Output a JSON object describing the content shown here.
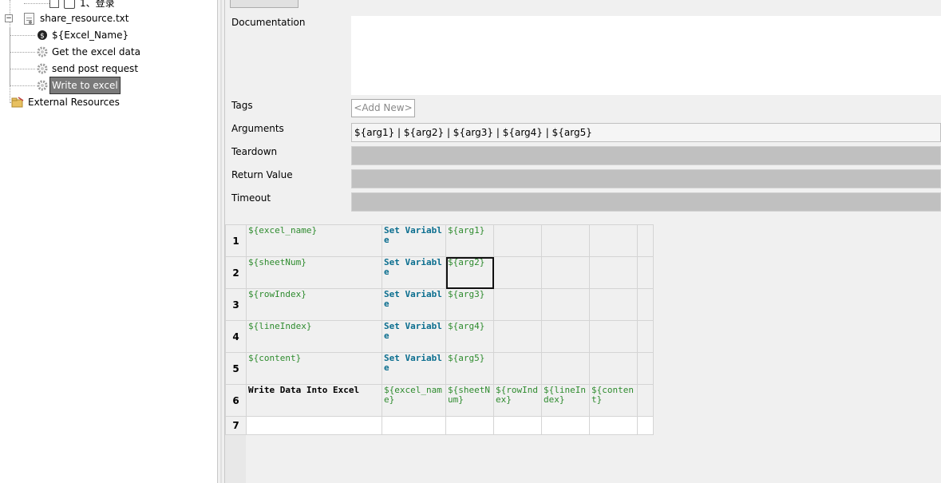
{
  "tree": {
    "top_item": "1、登录",
    "resource_file": "share_resource.txt",
    "children": [
      {
        "label": "${Excel_Name}",
        "icon": "variable-icon"
      },
      {
        "label": "Get the excel data",
        "icon": "gear-icon"
      },
      {
        "label": "send post request",
        "icon": "gear-icon"
      },
      {
        "label": "Write to excel",
        "icon": "gear-icon",
        "selected": true
      }
    ],
    "external": "External Resources"
  },
  "editor": {
    "fields": {
      "documentation": "Documentation",
      "tags": "Tags",
      "tags_add": "<Add New>",
      "arguments": "Arguments",
      "arguments_value": "${arg1} | ${arg2} | ${arg3} | ${arg4} | ${arg5}",
      "teardown": "Teardown",
      "return_value": "Return Value",
      "timeout": "Timeout"
    }
  },
  "grid": {
    "rows": [
      {
        "num": "1",
        "cells": [
          "${excel_name}",
          "Set Variable",
          "${arg1}",
          "",
          "",
          "",
          ""
        ]
      },
      {
        "num": "2",
        "cells": [
          "${sheetNum}",
          "Set Variable",
          "${arg2}",
          "",
          "",
          "",
          ""
        ]
      },
      {
        "num": "3",
        "cells": [
          "${rowIndex}",
          "Set Variable",
          "${arg3}",
          "",
          "",
          "",
          ""
        ]
      },
      {
        "num": "4",
        "cells": [
          "${lineIndex}",
          "Set Variable",
          "${arg4}",
          "",
          "",
          "",
          ""
        ]
      },
      {
        "num": "5",
        "cells": [
          "${content}",
          "Set Variable",
          "${arg5}",
          "",
          "",
          "",
          ""
        ]
      },
      {
        "num": "6",
        "cells": [
          "Write Data Into Excel",
          "${excel_name}",
          "${sheetNum}",
          "${rowIndex}",
          "${lineIndex}",
          "${content}",
          ""
        ]
      },
      {
        "num": "7",
        "cells": [
          "",
          "",
          "",
          "",
          "",
          "",
          ""
        ]
      }
    ],
    "selected_cell": "2-3"
  },
  "colors": {
    "variable": "#2e8b2e",
    "keyword": "#0b6e8f",
    "selection": "#7a7a7a"
  }
}
